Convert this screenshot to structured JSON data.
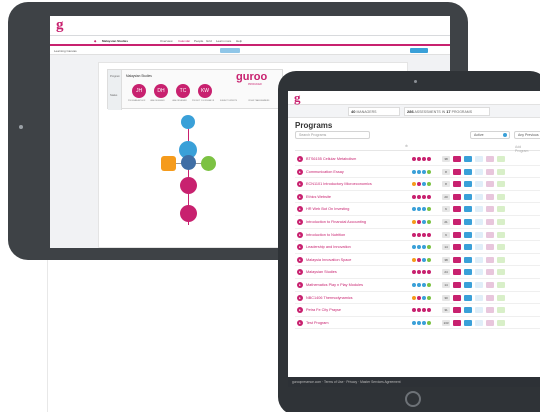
{
  "back_screen": {
    "logo": "g",
    "program_title": "Malaysian Studies",
    "nav": [
      "Overview",
      "Calendar",
      "People",
      "Grid",
      "Learn more",
      "Help"
    ],
    "learning_label": "Learning Canvas",
    "program_label": "Program",
    "program_name": "Malaysian Studies",
    "brand": "guroo",
    "brand_sub": "PRODUCER",
    "people": [
      {
        "initials": "JH",
        "role": "PROGRAM AUTHOR"
      },
      {
        "initials": "DH",
        "role": "LEAD DESIGNER"
      },
      {
        "initials": "TC",
        "role": "LEAD REVIEWER"
      },
      {
        "initials": "KW",
        "role": "PROJECT COORDINATOR"
      }
    ],
    "extra_roles": [
      "SUBJECT EXPERTS",
      "OTHER TEAM MEMBERS"
    ],
    "status_label": "Status"
  },
  "front_screen": {
    "logo": "g",
    "stats": [
      {
        "value": "40",
        "label": "MANAGERS"
      },
      {
        "value": "286",
        "label": "ASSESSMENTS IN",
        "value2": "17",
        "label2": "PROGRAMS"
      }
    ],
    "title": "Programs",
    "search_placeholder": "Search Programs",
    "filter_status": "Active",
    "filter_sort": "Any Previous",
    "add_program_label": "Add Program",
    "rows": [
      {
        "name": "BTS6155 Cellular Metabolism",
        "n": "38"
      },
      {
        "name": "Communication Essay",
        "n": "8"
      },
      {
        "name": "ECN1101 Introductory Microeconomics",
        "n": "8"
      },
      {
        "name": "Ethics Website",
        "n": "20"
      },
      {
        "name": "HR Web Bot On Investing",
        "n": "6"
      },
      {
        "name": "Introduction to Financial Accounting",
        "n": "21"
      },
      {
        "name": "Introduction to Nutrition",
        "n": "9"
      },
      {
        "name": "Leadership and Innovation",
        "n": "14"
      },
      {
        "name": "Malaysia Innovation Space",
        "n": "38"
      },
      {
        "name": "Malaysian Studies",
        "n": "24"
      },
      {
        "name": "Mathematics Play n Play Modules",
        "n": "14"
      },
      {
        "name": "NBC1406 Thermodynamics",
        "n": "30"
      },
      {
        "name": "Petra Fe City Prayse",
        "n": "31"
      },
      {
        "name": "Test Program",
        "n": "133"
      }
    ],
    "footer": "guroopresence.com · Terms of Use · Privacy · Master Services Agreement"
  },
  "colors": {
    "accent": "#c8216f",
    "orange": "#f59b1c",
    "blue": "#3aa0d8",
    "green": "#7cc243",
    "bezel": "#2f3337"
  }
}
